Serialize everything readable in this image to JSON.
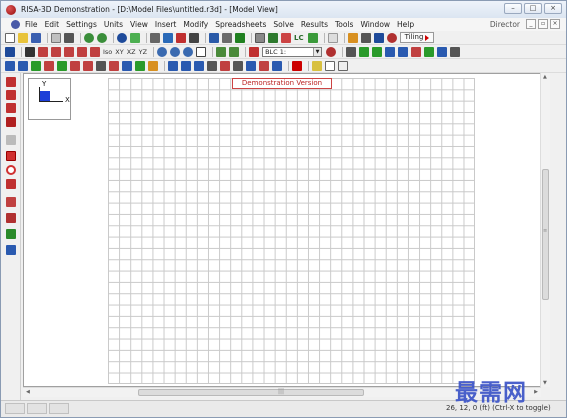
{
  "window": {
    "title": "RISA-3D Demonstration - [D:\\Model Files\\untitled.r3d] - [Model View]",
    "controls": [
      "–",
      "□",
      "×"
    ]
  },
  "menubar": {
    "items": [
      "File",
      "Edit",
      "Settings",
      "Units",
      "View",
      "Insert",
      "Modify",
      "Spreadsheets",
      "Solve",
      "Results",
      "Tools",
      "Window",
      "Help"
    ],
    "right_label": "Director",
    "mdi_controls": [
      "_",
      "▫",
      "×"
    ]
  },
  "toolbar1": {
    "lc_label": "LC",
    "tiling_label": "Tiling"
  },
  "toolbar2": {
    "view_labels": [
      "Iso",
      "XY",
      "XZ",
      "YZ"
    ],
    "load_combo_value": "BLC 1:"
  },
  "model_view": {
    "banner": "Demonstration Version",
    "axis_y": "Y",
    "axis_x": "X"
  },
  "statusbar": {
    "coordinates": "26, 12, 0 (ft)   (Ctrl-X to toggle)"
  },
  "watermark": "最需网",
  "colors": {
    "accent_blue": "#1d3fd8",
    "demo_red": "#b22222",
    "watermark_blue": "#3d55c8",
    "grid_line": "#c9c9c9"
  }
}
